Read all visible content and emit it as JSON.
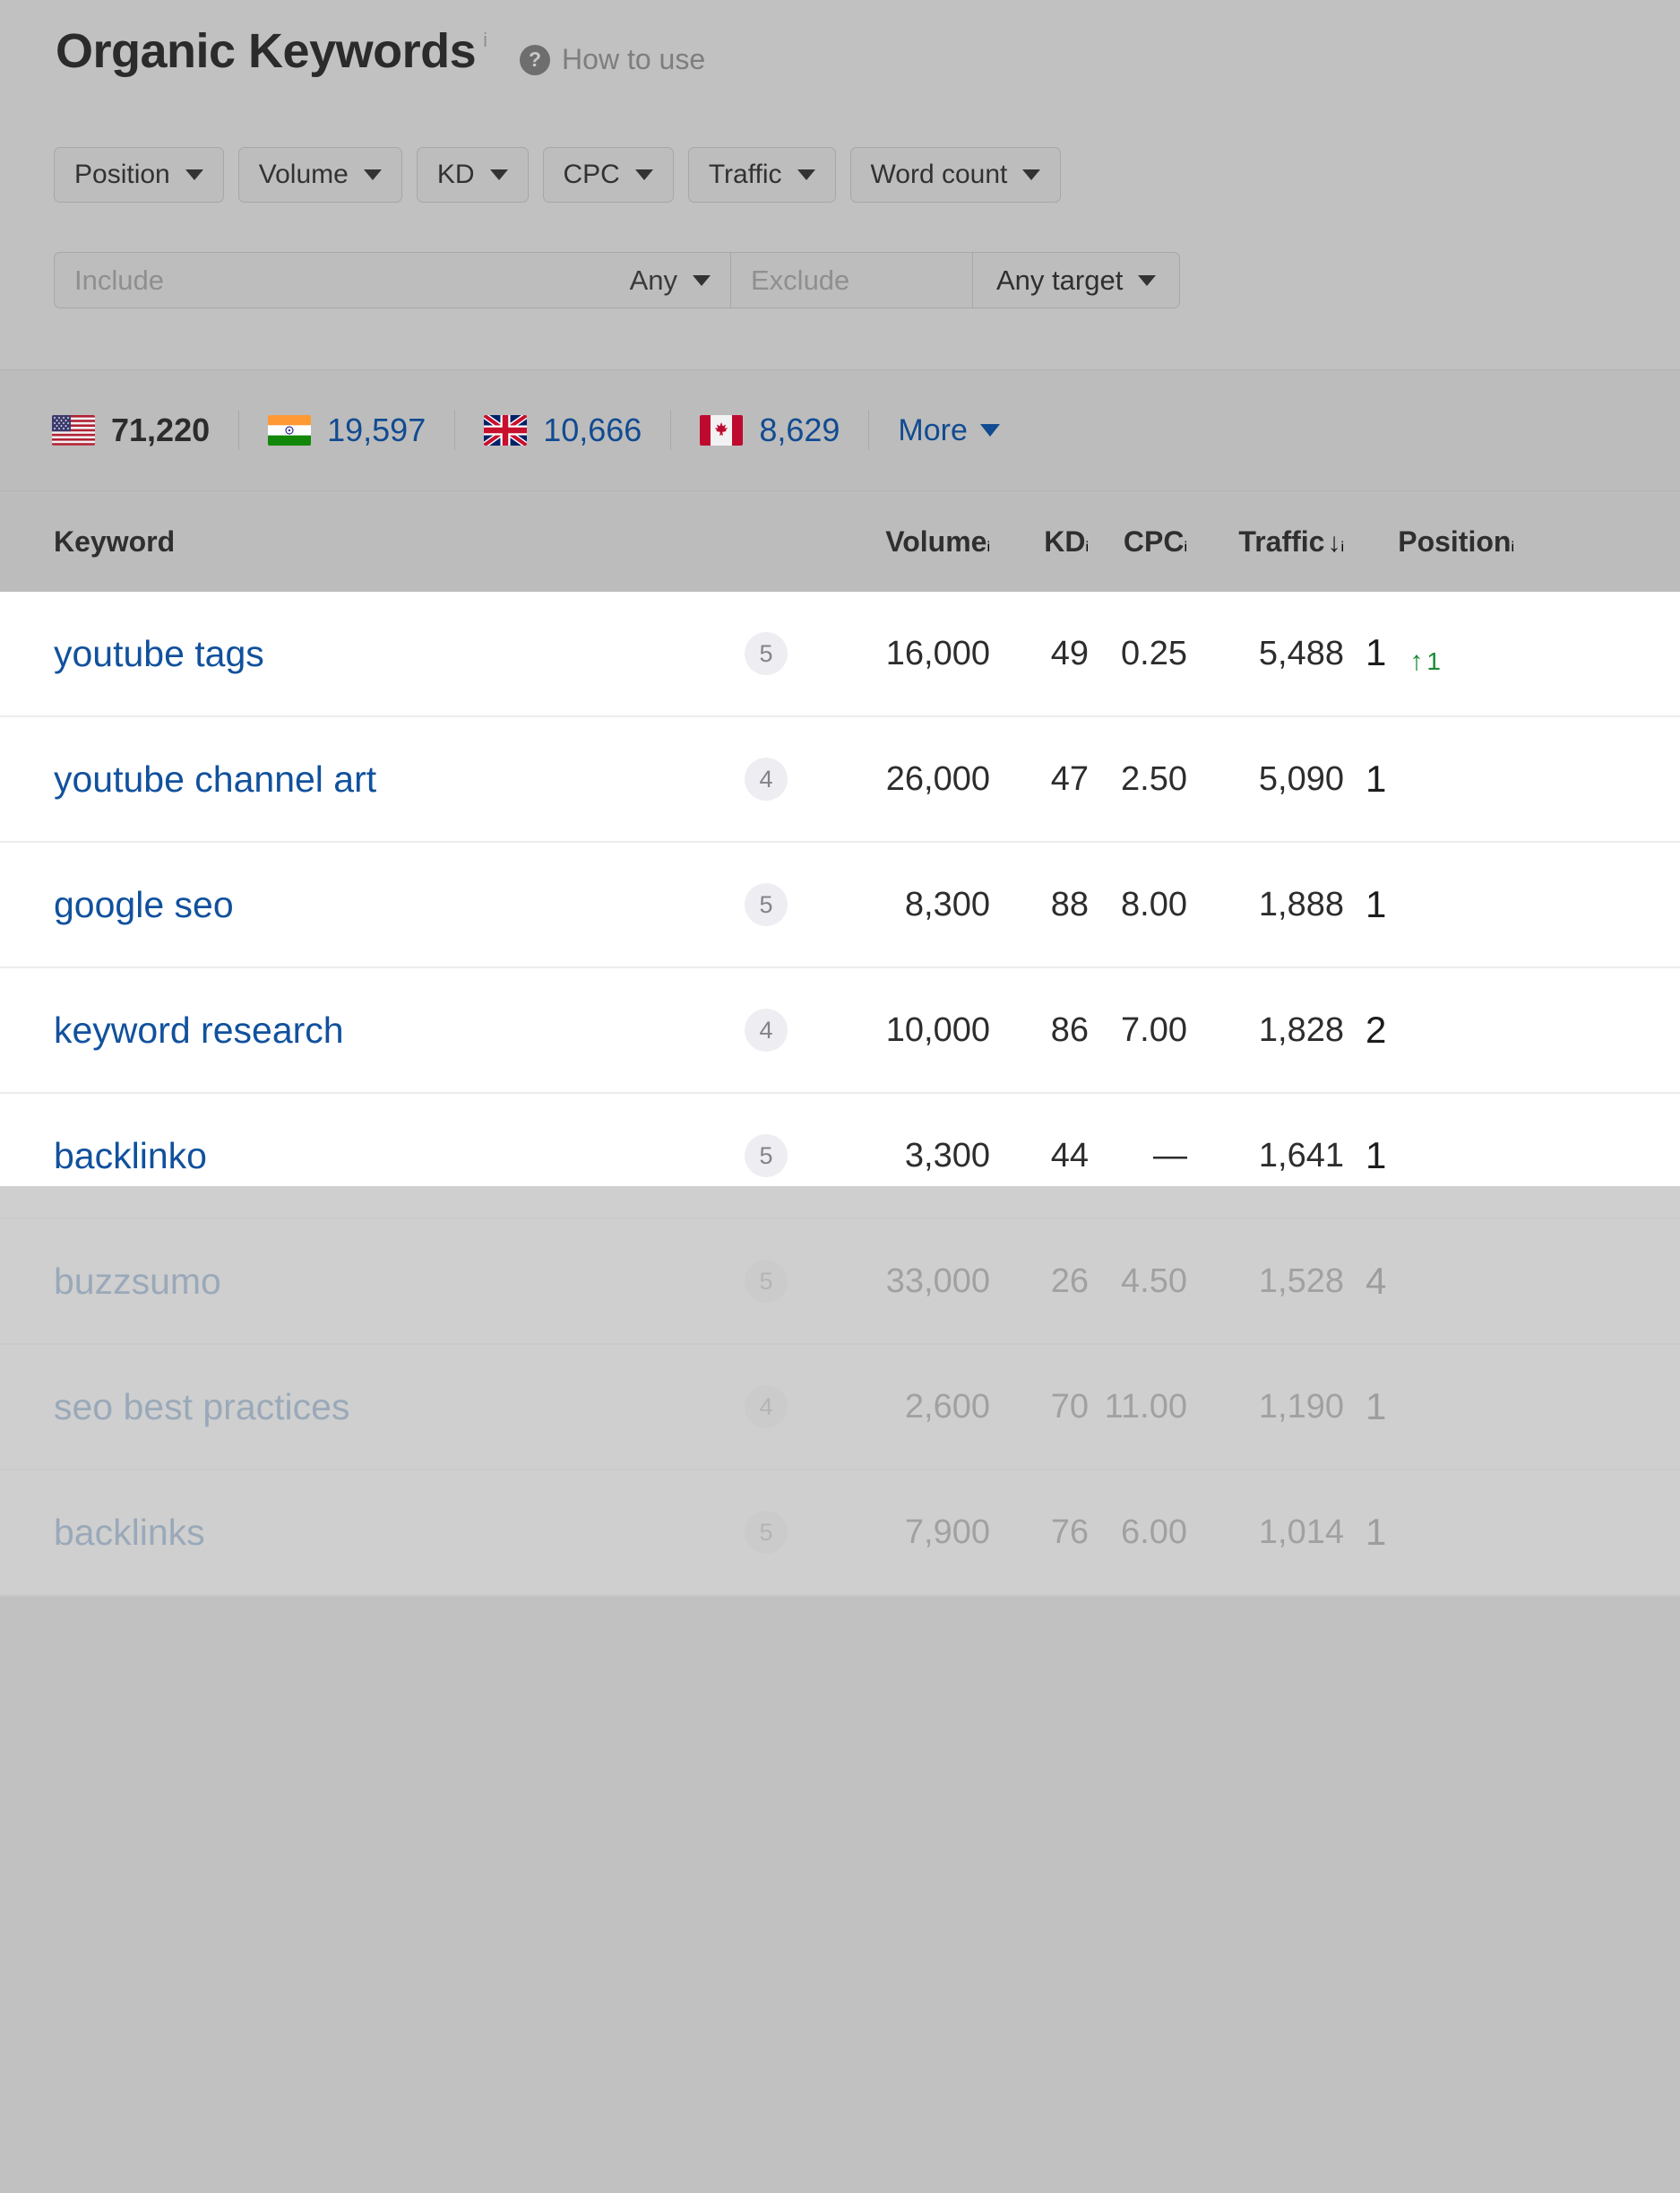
{
  "header": {
    "title": "Organic Keywords",
    "title_info_sup": "i",
    "help_icon": "question-mark-icon",
    "how_to_use_label": "How to use"
  },
  "filters": {
    "chips": [
      {
        "label": "Position"
      },
      {
        "label": "Volume"
      },
      {
        "label": "KD"
      },
      {
        "label": "CPC"
      },
      {
        "label": "Traffic"
      },
      {
        "label": "Word count"
      }
    ],
    "include_placeholder": "Include",
    "include_mode": "Any",
    "exclude_placeholder": "Exclude",
    "target_label": "Any target"
  },
  "countries": {
    "items": [
      {
        "flag": "us-flag-icon",
        "name": "United States",
        "count": "71,220",
        "active": true
      },
      {
        "flag": "india-flag-icon",
        "name": "India",
        "count": "19,597",
        "active": false
      },
      {
        "flag": "uk-flag-icon",
        "name": "United Kingdom",
        "count": "10,666",
        "active": false
      },
      {
        "flag": "canada-flag-icon",
        "name": "Canada",
        "count": "8,629",
        "active": false
      }
    ],
    "more_label": "More"
  },
  "table": {
    "columns": [
      {
        "key": "keyword",
        "label": "Keyword",
        "info": ""
      },
      {
        "key": "badge",
        "label": "",
        "info": ""
      },
      {
        "key": "volume",
        "label": "Volume",
        "info": "i"
      },
      {
        "key": "kd",
        "label": "KD",
        "info": "i"
      },
      {
        "key": "cpc",
        "label": "CPC",
        "info": "i"
      },
      {
        "key": "traffic",
        "label": "Traffic",
        "info": "i",
        "sorted": "desc",
        "sort_glyph": "↓"
      },
      {
        "key": "position",
        "label": "Position",
        "info": "i"
      }
    ],
    "rows": [
      {
        "keyword": "youtube tags",
        "badge": "5",
        "volume": "16,000",
        "kd": "49",
        "cpc": "0.25",
        "traffic": "5,488",
        "position": "1",
        "position_change_dir": "up",
        "position_change": "1"
      },
      {
        "keyword": "youtube channel art",
        "badge": "4",
        "volume": "26,000",
        "kd": "47",
        "cpc": "2.50",
        "traffic": "5,090",
        "position": "1",
        "position_change_dir": "",
        "position_change": ""
      },
      {
        "keyword": "google seo",
        "badge": "5",
        "volume": "8,300",
        "kd": "88",
        "cpc": "8.00",
        "traffic": "1,888",
        "position": "1",
        "position_change_dir": "",
        "position_change": ""
      },
      {
        "keyword": "keyword research",
        "badge": "4",
        "volume": "10,000",
        "kd": "86",
        "cpc": "7.00",
        "traffic": "1,828",
        "position": "2",
        "position_change_dir": "",
        "position_change": ""
      },
      {
        "keyword": "backlinko",
        "badge": "5",
        "volume": "3,300",
        "kd": "44",
        "cpc": "—",
        "traffic": "1,641",
        "position": "1",
        "position_change_dir": "",
        "position_change": ""
      },
      {
        "keyword": "buzzsumo",
        "badge": "5",
        "volume": "33,000",
        "kd": "26",
        "cpc": "4.50",
        "traffic": "1,528",
        "position": "4",
        "position_change_dir": "",
        "position_change": ""
      },
      {
        "keyword": "seo best practices",
        "badge": "4",
        "volume": "2,600",
        "kd": "70",
        "cpc": "11.00",
        "traffic": "1,190",
        "position": "1",
        "position_change_dir": "",
        "position_change": ""
      },
      {
        "keyword": "backlinks",
        "badge": "5",
        "volume": "7,900",
        "kd": "76",
        "cpc": "6.00",
        "traffic": "1,014",
        "position": "1",
        "position_change_dir": "",
        "position_change": ""
      }
    ]
  },
  "colors": {
    "page_background": "#c1c1c1",
    "link_blue": "#11519d",
    "text_dark": "#2b2b2b",
    "muted_grey": "#8f8f8f",
    "positive_green": "#1b8a33",
    "badge_background": "#eeeef2",
    "row_background": "#ffffff"
  }
}
